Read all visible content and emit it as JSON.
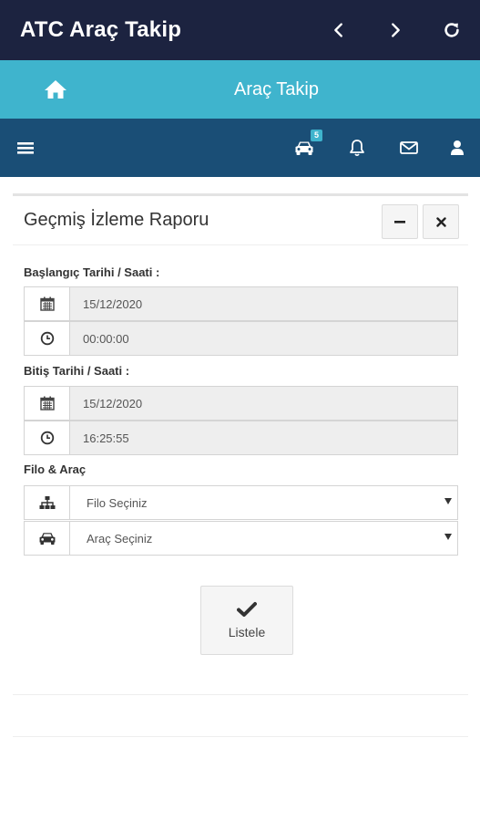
{
  "appbar": {
    "title": "ATC Araç Takip",
    "icons": [
      "chevron-left-icon",
      "chevron-right-icon",
      "refresh-icon"
    ]
  },
  "subheader": {
    "title": "Araç Takip",
    "icon": "home-icon"
  },
  "toolbar": {
    "icons": [
      "menu-icon",
      "car-icon",
      "bell-icon",
      "envelope-icon",
      "user-icon"
    ],
    "car_badge": "5"
  },
  "panel": {
    "title": "Geçmiş İzleme Raporu",
    "start_label": "Başlangıç Tarihi / Saati :",
    "start_date": "15/12/2020",
    "start_time": "00:00:00",
    "end_label": "Bitiş Tarihi / Saati :",
    "end_date": "15/12/2020",
    "end_time": "16:25:55",
    "fleet_label": "Filo & Araç",
    "fleet_select": "Filo Seçiniz",
    "vehicle_select": "Araç Seçiniz",
    "list_button": "Listele"
  },
  "colors": {
    "appbar": "#1c2340",
    "subheader": "#3fb4cd",
    "toolbar": "#1a4e76",
    "badge": "#3fb4cd"
  }
}
